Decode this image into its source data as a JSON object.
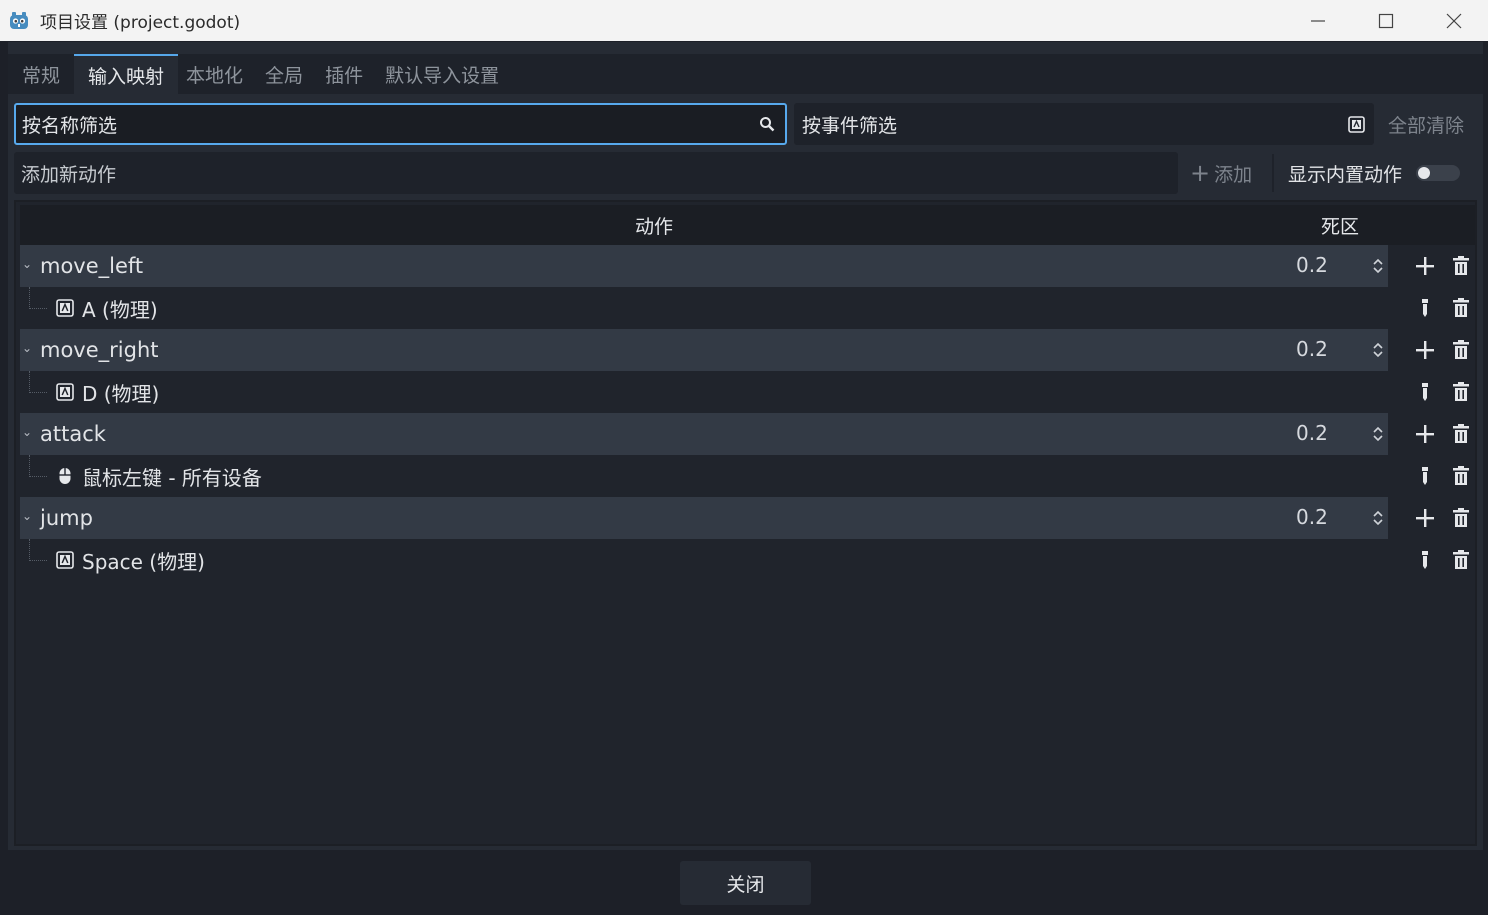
{
  "window": {
    "title": "项目设置 (project.godot)"
  },
  "tabs": [
    {
      "label": "常规"
    },
    {
      "label": "输入映射"
    },
    {
      "label": "本地化"
    },
    {
      "label": "全局"
    },
    {
      "label": "插件"
    },
    {
      "label": "默认导入设置"
    }
  ],
  "filters": {
    "by_name": "按名称筛选",
    "by_event": "按事件筛选",
    "clear_all": "全部清除"
  },
  "add_action": {
    "placeholder": "添加新动作",
    "add_label": "添加",
    "show_builtin_label": "显示内置动作"
  },
  "tree": {
    "col_action": "动作",
    "col_deadzone": "死区",
    "actions": [
      {
        "name": "move_left",
        "deadzone": "0.2",
        "event": "A (物理)",
        "event_icon": "keyboard-icon"
      },
      {
        "name": "move_right",
        "deadzone": "0.2",
        "event": "D (物理)",
        "event_icon": "keyboard-icon"
      },
      {
        "name": "attack",
        "deadzone": "0.2",
        "event": "鼠标左键 - 所有设备",
        "event_icon": "mouse-icon"
      },
      {
        "name": "jump",
        "deadzone": "0.2",
        "event": "Space (物理)",
        "event_icon": "keyboard-icon"
      }
    ]
  },
  "footer": {
    "close_label": "关闭"
  },
  "colors": {
    "accent": "#57a9ed",
    "panel": "#262b34",
    "row": "#333a45"
  }
}
